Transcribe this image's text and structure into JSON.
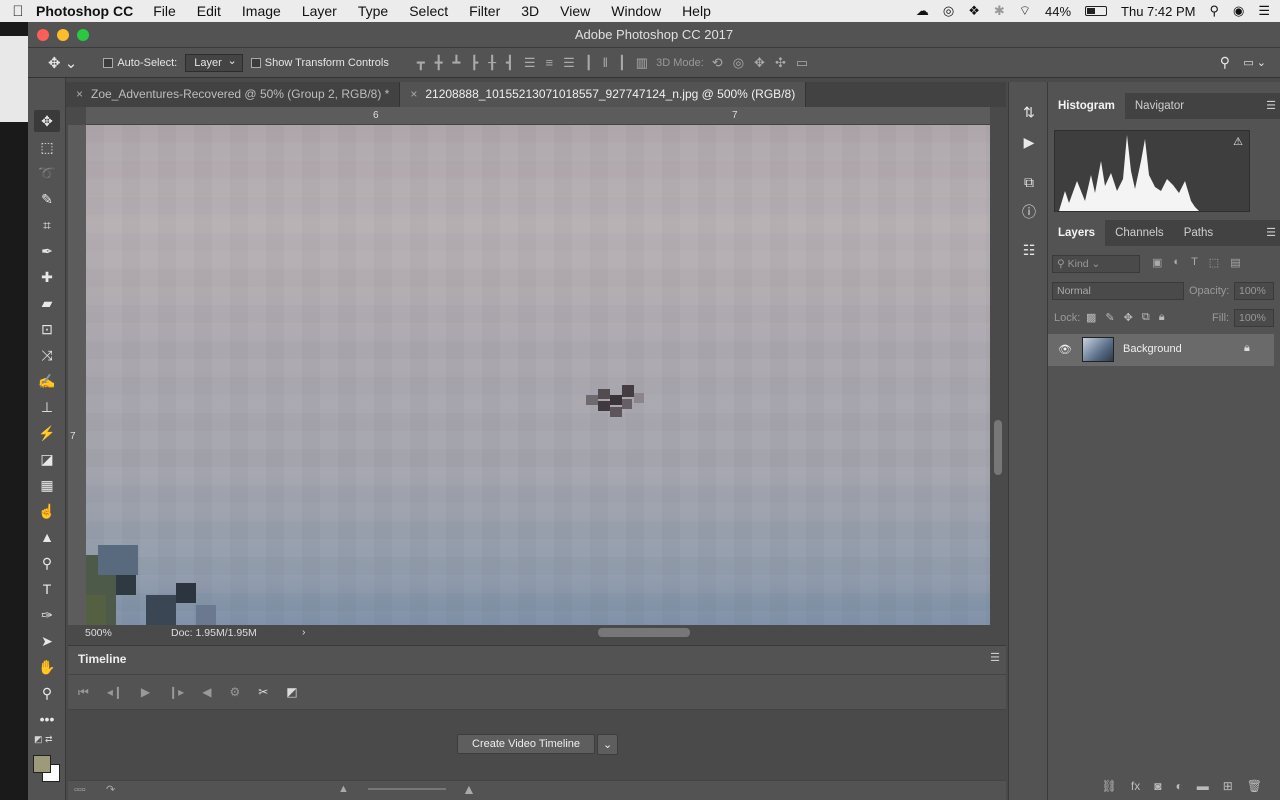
{
  "menubar": {
    "app": "Photoshop CC",
    "items": [
      "File",
      "Edit",
      "Image",
      "Layer",
      "Type",
      "Select",
      "Filter",
      "3D",
      "View",
      "Window",
      "Help"
    ],
    "battery": "44%",
    "clock": "Thu 7:42 PM"
  },
  "window": {
    "title": "Adobe Photoshop CC 2017"
  },
  "options": {
    "auto_select_label": "Auto-Select:",
    "auto_select_value": "Layer",
    "show_transform_label": "Show Transform Controls",
    "mode_3d_label": "3D Mode:"
  },
  "tabs": [
    {
      "label": "Zoe_Adventures-Recovered @ 50% (Group 2, RGB/8) *"
    },
    {
      "label": "21208888_10155213071018557_927747124_n.jpg @ 500% (RGB/8)"
    }
  ],
  "rulers": {
    "top_marks": [
      "6",
      "7"
    ],
    "left_marks": [
      "7"
    ]
  },
  "status": {
    "zoom": "500%",
    "doc": "Doc: 1.95M/1.95M"
  },
  "timeline": {
    "title": "Timeline",
    "create_button": "Create Video Timeline"
  },
  "panels": {
    "top_tabs": [
      "Histogram",
      "Navigator"
    ],
    "layer_tabs": [
      "Layers",
      "Channels",
      "Paths"
    ],
    "kind_placeholder": "Kind",
    "blend_mode": "Normal",
    "opacity_label": "Opacity:",
    "opacity_value": "100%",
    "lock_label": "Lock:",
    "fill_label": "Fill:",
    "fill_value": "100%",
    "layer_name": "Background"
  },
  "colors": {
    "panel": "#535353",
    "foreground_swatch": "#9c9a7a",
    "background_swatch": "#ffffff"
  }
}
